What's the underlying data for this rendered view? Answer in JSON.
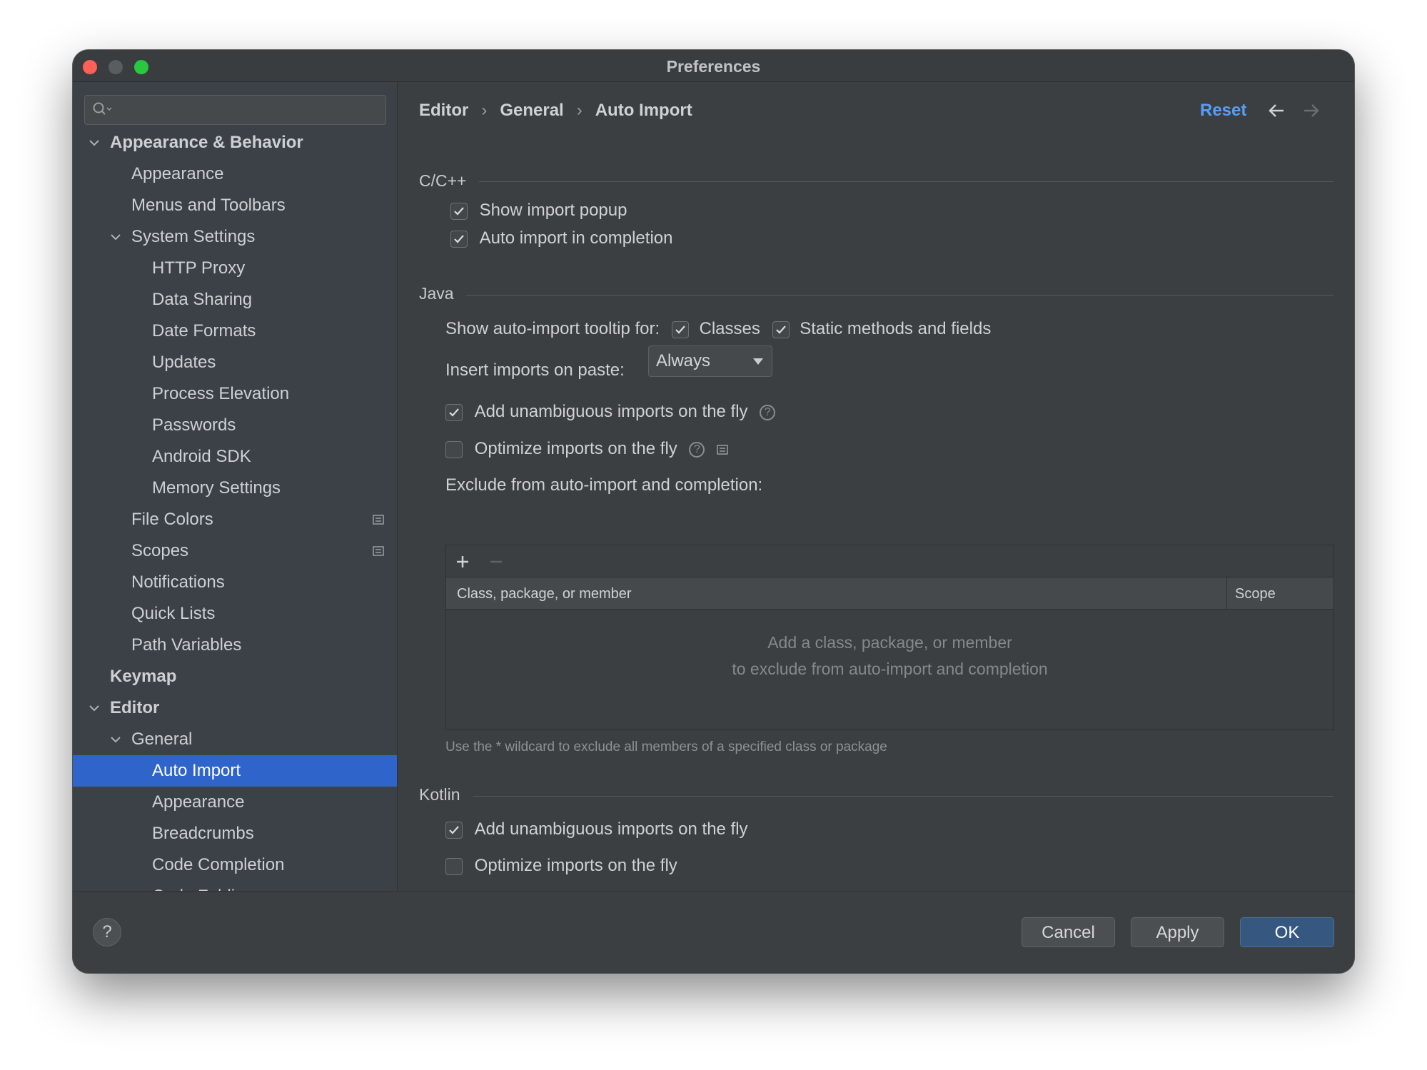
{
  "window": {
    "title": "Preferences"
  },
  "sidebar": {
    "search_placeholder": "",
    "items": [
      {
        "label": "Appearance & Behavior",
        "level": 0,
        "bold": true,
        "expanded": true
      },
      {
        "label": "Appearance",
        "level": 1
      },
      {
        "label": "Menus and Toolbars",
        "level": 1
      },
      {
        "label": "System Settings",
        "level": 1,
        "expanded": true
      },
      {
        "label": "HTTP Proxy",
        "level": 2
      },
      {
        "label": "Data Sharing",
        "level": 2
      },
      {
        "label": "Date Formats",
        "level": 2
      },
      {
        "label": "Updates",
        "level": 2
      },
      {
        "label": "Process Elevation",
        "level": 2
      },
      {
        "label": "Passwords",
        "level": 2
      },
      {
        "label": "Android SDK",
        "level": 2
      },
      {
        "label": "Memory Settings",
        "level": 2
      },
      {
        "label": "File Colors",
        "level": 1,
        "project_icon": true
      },
      {
        "label": "Scopes",
        "level": 1,
        "project_icon": true
      },
      {
        "label": "Notifications",
        "level": 1
      },
      {
        "label": "Quick Lists",
        "level": 1
      },
      {
        "label": "Path Variables",
        "level": 1
      },
      {
        "label": "Keymap",
        "level": 0,
        "bold": true
      },
      {
        "label": "Editor",
        "level": 0,
        "bold": true,
        "expanded": true
      },
      {
        "label": "General",
        "level": 1,
        "expanded": true
      },
      {
        "label": "Auto Import",
        "level": 2,
        "selected": true
      },
      {
        "label": "Appearance",
        "level": 2
      },
      {
        "label": "Breadcrumbs",
        "level": 2
      },
      {
        "label": "Code Completion",
        "level": 2
      },
      {
        "label": "Code Folding",
        "level": 2
      }
    ]
  },
  "breadcrumb": {
    "items": [
      "Editor",
      "General",
      "Auto Import"
    ],
    "reset_label": "Reset"
  },
  "cpp": {
    "title": "C/C++",
    "show_import_popup": {
      "label": "Show import popup",
      "checked": true
    },
    "auto_import_completion": {
      "label": "Auto import in completion",
      "checked": true
    }
  },
  "java": {
    "title": "Java",
    "tooltip_label": "Show auto-import tooltip for:",
    "classes": {
      "label": "Classes",
      "checked": true
    },
    "static_methods": {
      "label": "Static methods and fields",
      "checked": true
    },
    "paste_label": "Insert imports on paste:",
    "paste_value": "Always",
    "add_unambiguous": {
      "label": "Add unambiguous imports on the fly",
      "checked": true
    },
    "optimize": {
      "label": "Optimize imports on the fly",
      "checked": false
    },
    "exclude_label": "Exclude from auto-import and completion:",
    "table": {
      "columns": [
        "Class, package, or member",
        "Scope"
      ],
      "empty_line1": "Add a class, package, or member",
      "empty_line2": "to exclude from auto-import and completion"
    },
    "hint": "Use the * wildcard to exclude all members of a specified class or package"
  },
  "kotlin": {
    "title": "Kotlin",
    "add_unambiguous": {
      "label": "Add unambiguous imports on the fly",
      "checked": true
    },
    "optimize": {
      "label": "Optimize imports on the fly",
      "checked": false
    }
  },
  "footer": {
    "help": "?",
    "cancel": "Cancel",
    "apply": "Apply",
    "ok": "OK"
  },
  "colors": {
    "accent": "#589df6",
    "selection": "#2f65ca",
    "ok_button": "#365880"
  }
}
